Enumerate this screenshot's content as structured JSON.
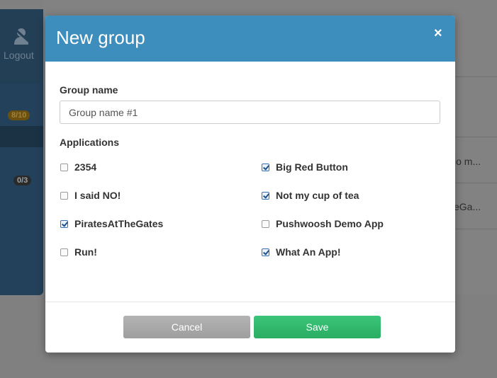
{
  "background": {
    "sidebar": {
      "logout_label": "Logout",
      "badges": [
        "8/10",
        "0/3"
      ]
    },
    "rows": [
      "io m...",
      "eGa..."
    ]
  },
  "modal": {
    "title": "New group",
    "close_symbol": "×",
    "group_name_label": "Group name",
    "group_name_value": "Group name #1",
    "applications_label": "Applications",
    "applications": [
      {
        "name": "2354",
        "checked": false
      },
      {
        "name": "Big Red Button",
        "checked": true
      },
      {
        "name": "I said NO!",
        "checked": false
      },
      {
        "name": "Not my cup of tea",
        "checked": true
      },
      {
        "name": "PiratesAtTheGates",
        "checked": true
      },
      {
        "name": "Pushwoosh Demo App",
        "checked": false
      },
      {
        "name": "Run!",
        "checked": false
      },
      {
        "name": "What An App!",
        "checked": true
      }
    ],
    "cancel_label": "Cancel",
    "save_label": "Save"
  },
  "colors": {
    "header": "#3d8ebc",
    "save": "#2fb86b",
    "cancel": "#a8a8a8"
  }
}
